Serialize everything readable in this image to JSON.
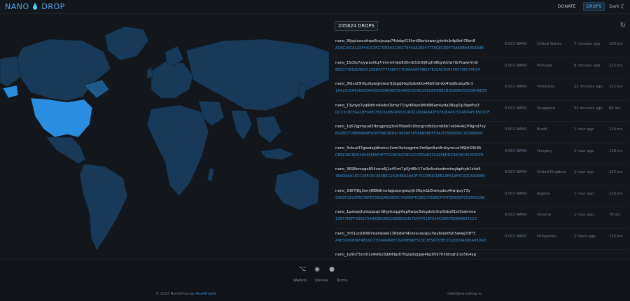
{
  "header": {
    "logo_left": "NANO",
    "logo_right": "DROP",
    "nav": [
      {
        "label": "DONATE",
        "active": false
      },
      {
        "label": "DROPS",
        "active": true
      },
      {
        "label": "Dark",
        "active": false
      }
    ]
  },
  "feed": {
    "total_label": "205824 DROPS",
    "rows": [
      {
        "address": "nano_3fjopiueeufnpx8csjxuqo74dxbpf15km99orkxwacjytehhib4p9oh76dn8",
        "hash": "A3AC18CA125F442C3FC70D9A3100C79F43A2E047776C8CD0F70A69BA4056A88",
        "amount": "0.001 NANO",
        "country": "United States",
        "time": "7 minutes ago",
        "ms": "100 ms"
      },
      {
        "address": "nano_15d5s7xjywashtq7nhmmfnke8d5nrb53n6jfhqfn86gnkkfw7ib7kawrfm3r",
        "hash": "8EC077862D9B5C338DA7F7F380F77C89A0AF48D37E20AC9391F85790CF0F24",
        "amount": "0.001 NANO",
        "country": "Portugal",
        "time": "8 minutes ago",
        "ms": "112 ms"
      },
      {
        "address": "nano_3fdxaf3hfqu5pwgtowuti1fpgq9ixp5pkwtko48b5tdmkk4hjdibutqzfbr1",
        "hash": "1AA2535A626ACDA0D2D33A08D59145072C6D20E28DB6B1BD083AD5C03D46EE5",
        "amount": "0.001 NANO",
        "country": "Honduras",
        "time": "22 minutes ago",
        "ms": "122 ms"
      },
      {
        "address": "nano_13ydye7yq9drhn4ssbd1kmjr71tjy96hyo9tb686amkyda38ygi1p3qwfhx3",
        "hash": "DCC3C8CFAA1BF04ECFDC618BD4553C4DD1DD4A540F3780D4DC5D4D84FCE9C91F",
        "amount": "0.001 NANO",
        "country": "Singapore",
        "time": "32 minutes ago",
        "ms": "80 ms"
      },
      {
        "address": "nano_1q57gpmpud3fbngpdzg3o476be6h18ocgnn8d1om68b7sk94s4q7f9gnd7xy",
        "hash": "E0280773BE8984E5D0F39D2BD474824E1658889BE5F342F2589995C3C99AB49",
        "amount": "0.001 NANO",
        "country": "Brazil",
        "time": "1 hour ago",
        "ms": "124 ms"
      },
      {
        "address": "nano_3nbuz37gosdaijdtmkcc3zmt3uhragntm3m6pn8un8rzkymcco3f9jtt33h95",
        "hash": "CE5816C6D02854E6FAF2F77023CA0C9D2037FDAE3752AF8DDC4AF8C053C82F8",
        "amount": "0.001 NANO",
        "country": "Hungary",
        "time": "1 hour ago",
        "ms": "118 ms"
      },
      {
        "address": "nano_3698emaqo854xmx6j1e45rni7p5jh85r17w3e4cxhednmtwybpfcyb1shd4",
        "hash": "38ADE6A1ECC28FC9C3E3B8C2820B502A69F76CDB0D1EB23FE19F4C0DC5098AD",
        "amount": "0.001 NANO",
        "country": "United Kingdom",
        "time": "1 hour ago",
        "ms": "114 ms"
      },
      {
        "address": "nano_3i8f7j8g3emjf88k8mufagizqsrgwqnjh36qix1b5iwnpdeu4twrpzy73y",
        "hash": "5A83F1920FBC76FB75602A600E9C7A5B0F4C5B17069BCF47F0D60DFC02A92196",
        "amount": "0.001 NANO",
        "country": "Algeria",
        "time": "1 hour ago",
        "ms": "129 ms"
      },
      {
        "address": "nano_1pxkaejtuhbspzqnh8ypfczqghfqp9wipc5skgdsiic5rp5bbs81zt3odmme",
        "hash": "1397760FF935175A4EB6096633BB6324271647616F524CD8575E9A8637123",
        "amount": "0.001 NANO",
        "country": "Ukraine",
        "time": "1 hour ago",
        "ms": "78 ms"
      },
      {
        "address": "nano_3n51ucji9h6hmahqswk136bdsrh4ozssuouspu7wy8zeetfyh5wwg7i8*3",
        "hash": "A9E3D808FAF4B10C7350A8406FC8208B90F513C7E56733ECD12DD8A005A89DA3",
        "amount": "0.001 NANO",
        "country": "Philippines",
        "time": "2 hours ago",
        "ms": "125 ms"
      },
      {
        "address": "nano_1y9o73zo3t1o4slikz3jb66bp87foyjq9zpgw4bg9597h5htoqh11o5fs4yg",
        "hash": "",
        "amount": "",
        "country": "",
        "time": "",
        "ms": ""
      }
    ]
  },
  "footer": {
    "icons": [
      "github-icon",
      "discord-icon",
      "reddit-icon"
    ],
    "links": [
      "Wallets",
      "Donate",
      "Terms"
    ],
    "copyright_prefix": "© 2023 NanoDrop by",
    "copyright_link": "AnarKrypto",
    "email": "hello@nanodrop.io"
  },
  "colors": {
    "accent": "#3d8fd1",
    "map_land": "#17344f",
    "map_highlight": "#2a8ee0",
    "background": "#13171c"
  }
}
